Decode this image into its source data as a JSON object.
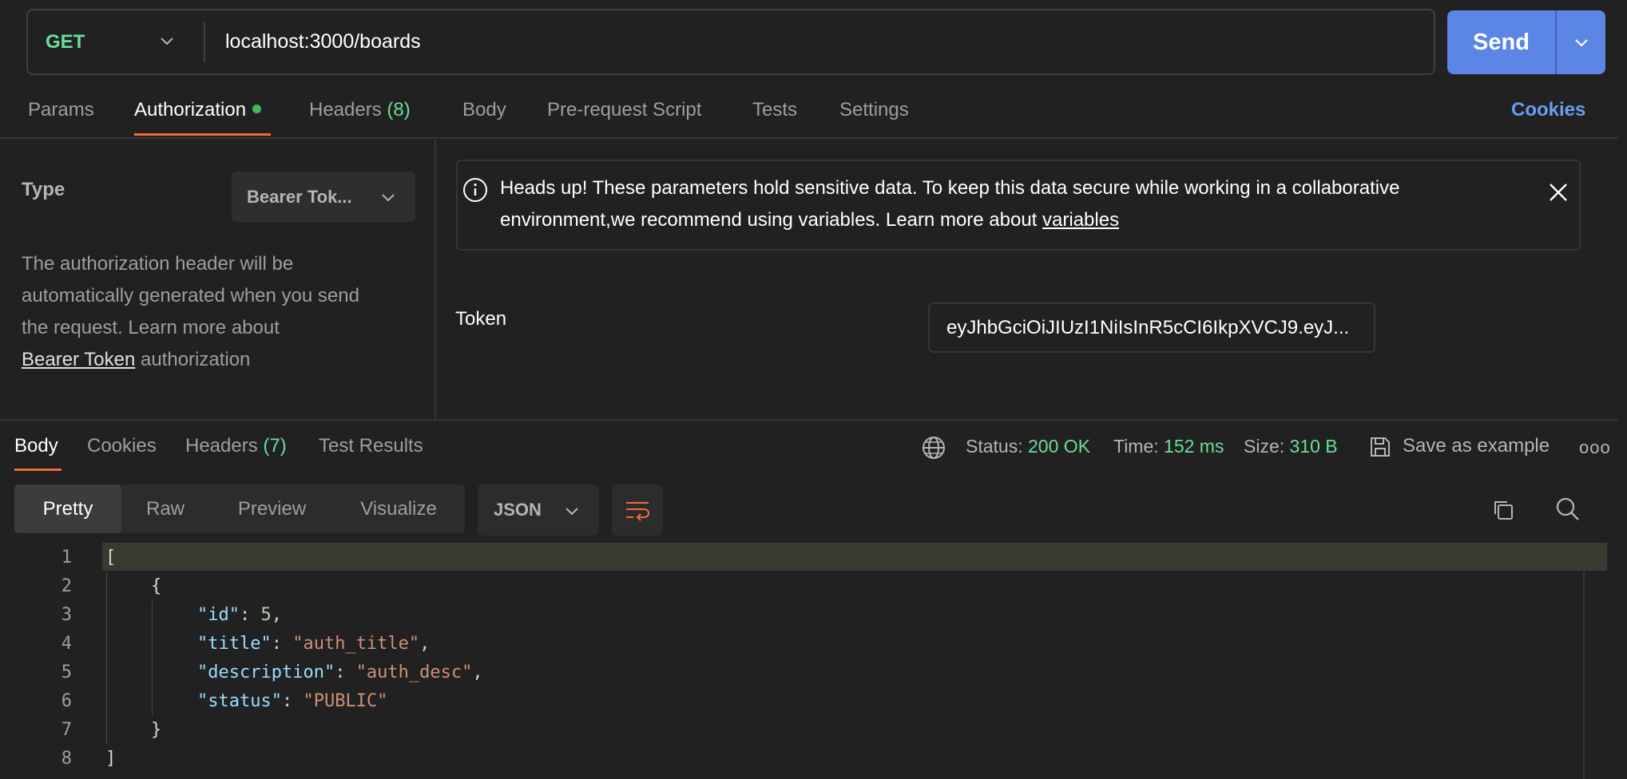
{
  "request": {
    "method": "GET",
    "url": "localhost:3000/boards",
    "send_label": "Send"
  },
  "request_tabs": [
    {
      "label": "Params"
    },
    {
      "label": "Authorization",
      "indicator": "green-dot",
      "active": true
    },
    {
      "label": "Headers",
      "count": "(8)"
    },
    {
      "label": "Body"
    },
    {
      "label": "Pre-request Script"
    },
    {
      "label": "Tests"
    },
    {
      "label": "Settings"
    }
  ],
  "cookies_link": "Cookies",
  "auth": {
    "type_label": "Type",
    "type_value": "Bearer Tok...",
    "desc_1": "The authorization header will be",
    "desc_2": "automatically generated when you send",
    "desc_3": "the request. Learn more about",
    "desc_link": "Bearer Token",
    "desc_after": " authorization",
    "notice_1": "Heads up! These parameters hold sensitive data. To keep this data secure while working in a collaborative",
    "notice_2": "environment,we recommend using variables. Learn more about ",
    "notice_link": "variables",
    "token_label": "Token",
    "token_value": "eyJhbGciOiJIUzI1NiIsInR5cCI6IkpXVCJ9.eyJ..."
  },
  "response_tabs": [
    {
      "label": "Body",
      "active": true
    },
    {
      "label": "Cookies"
    },
    {
      "label": "Headers",
      "count": "(7)"
    },
    {
      "label": "Test Results"
    }
  ],
  "status": {
    "status_label": "Status:",
    "status_value": "200 OK",
    "time_label": "Time:",
    "time_value": "152 ms",
    "size_label": "Size:",
    "size_value": "310 B",
    "save_label": "Save as example",
    "more": "ooo"
  },
  "view_modes": [
    "Pretty",
    "Raw",
    "Preview",
    "Visualize"
  ],
  "active_view": "Pretty",
  "format": "JSON",
  "code_lines": [
    "1",
    "2",
    "3",
    "4",
    "5",
    "6",
    "7",
    "8"
  ],
  "response_json": {
    "open_bracket": "[",
    "open_brace": "{",
    "id_key": "\"id\"",
    "id_value": "5",
    "title_key": "\"title\"",
    "title_value": "\"auth_title\"",
    "description_key": "\"description\"",
    "description_value": "\"auth_desc\"",
    "status_key": "\"status\"",
    "status_value": "\"PUBLIC\"",
    "close_brace": "}",
    "close_bracket": "]"
  },
  "colors": {
    "accent_blue": "#5b86e5",
    "method_green": "#6bdd9a",
    "tab_underline": "#f26b3a",
    "link_blue": "#6b9bf2"
  }
}
